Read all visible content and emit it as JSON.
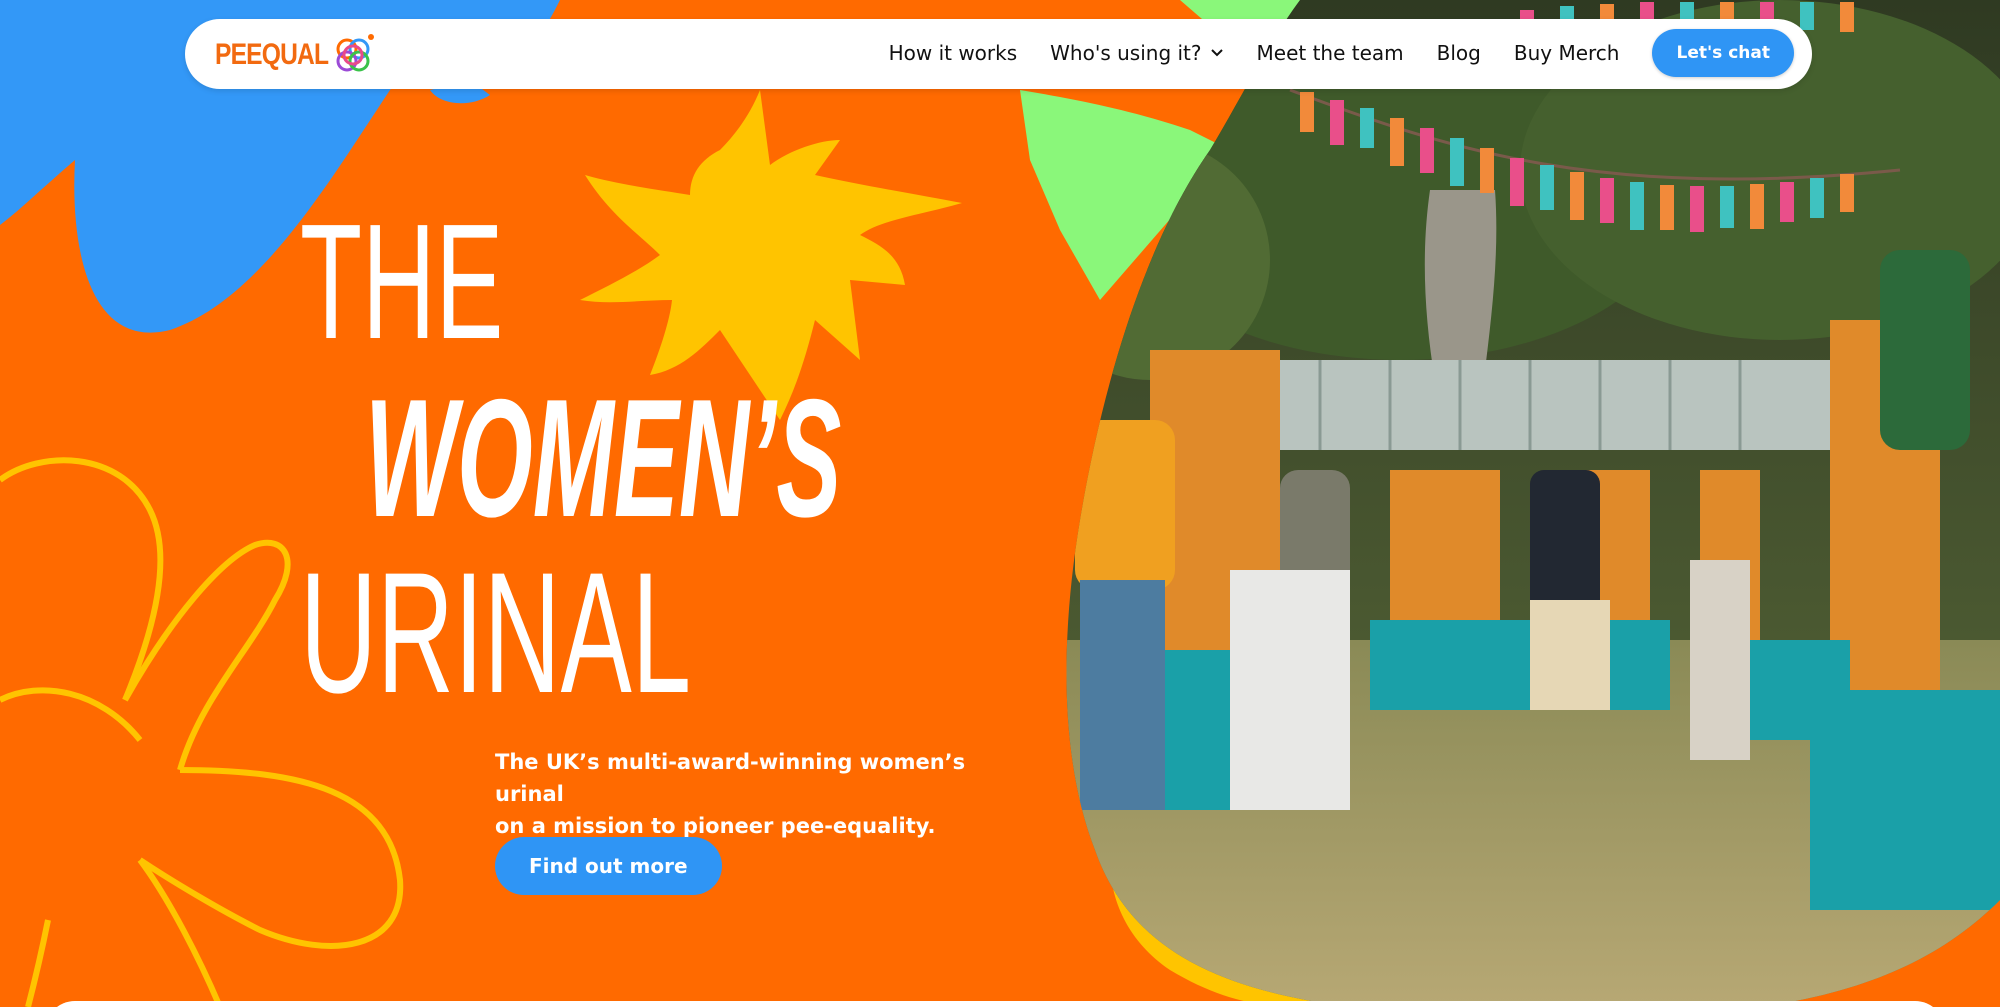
{
  "brand": {
    "name": "PEEQUAL"
  },
  "nav": {
    "links": [
      "How it works",
      "Who's using it?",
      "Meet the team",
      "Blog",
      "Buy Merch"
    ],
    "cta": "Let's chat"
  },
  "hero": {
    "heading_line1": "THE",
    "heading_line2": "WOMEN’S",
    "heading_line3": "URINAL",
    "subtitle_line1": "The UK’s multi-award-winning women’s urinal",
    "subtitle_line2": "on a mission to pioneer pee-equality.",
    "cta": "Find out more",
    "photo_label": "",
    "photo_tshirt_text": ""
  },
  "colors": {
    "orange": "#ff6a00",
    "blue": "#3398f7",
    "yellow": "#ffc400",
    "green": "#8af77a",
    "white": "#ffffff"
  },
  "icons": [
    "peequal-logo-icon",
    "chevron-down-icon",
    "sun-shape-icon",
    "flower-outline-icon"
  ]
}
